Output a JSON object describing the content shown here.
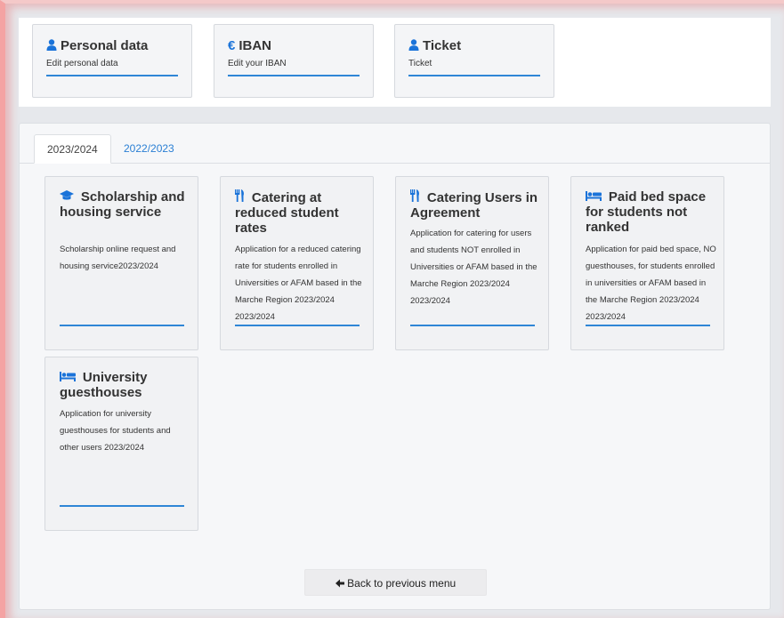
{
  "quick_links": [
    {
      "title": "Personal data",
      "subtitle": "Edit personal data",
      "icon": "user-icon"
    },
    {
      "title": "IBAN",
      "subtitle": "Edit your IBAN",
      "icon": "euro-icon"
    },
    {
      "title": "Ticket",
      "subtitle": "Ticket",
      "icon": "user-icon"
    }
  ],
  "tabs": [
    {
      "label": "2023/2024",
      "active": true
    },
    {
      "label": "2022/2023",
      "active": false
    }
  ],
  "services": [
    {
      "title": "Scholarship and housing service",
      "icon": "graduation-cap-icon",
      "description": "Scholarship online request and housing service2023/2024"
    },
    {
      "title": "Catering at reduced student rates",
      "icon": "utensils-icon",
      "description": "Application for a reduced catering rate for students enrolled in Universities or AFAM based in the Marche Region 2023/2024 2023/2024"
    },
    {
      "title": "Catering Users in Agreement",
      "icon": "utensils-icon",
      "description": "Application for catering for users and students NOT enrolled in Universities or AFAM based in the Marche Region 2023/2024 2023/2024"
    },
    {
      "title": "Paid bed space for students not ranked",
      "icon": "bed-icon",
      "description": "Application for paid bed space, NO guesthouses, for students enrolled in universities or AFAM based in the Marche Region 2023/2024 2023/2024"
    },
    {
      "title": "University guesthouses",
      "icon": "bed-icon",
      "description": "Application for university guesthouses for students and other users 2023/2024"
    }
  ],
  "back_button": {
    "label": "Back to previous menu",
    "icon": "arrow-left-icon"
  },
  "colors": {
    "accent": "#2f86d6",
    "icon_blue": "#1a73d9",
    "tab_link": "#2a7fd4"
  }
}
